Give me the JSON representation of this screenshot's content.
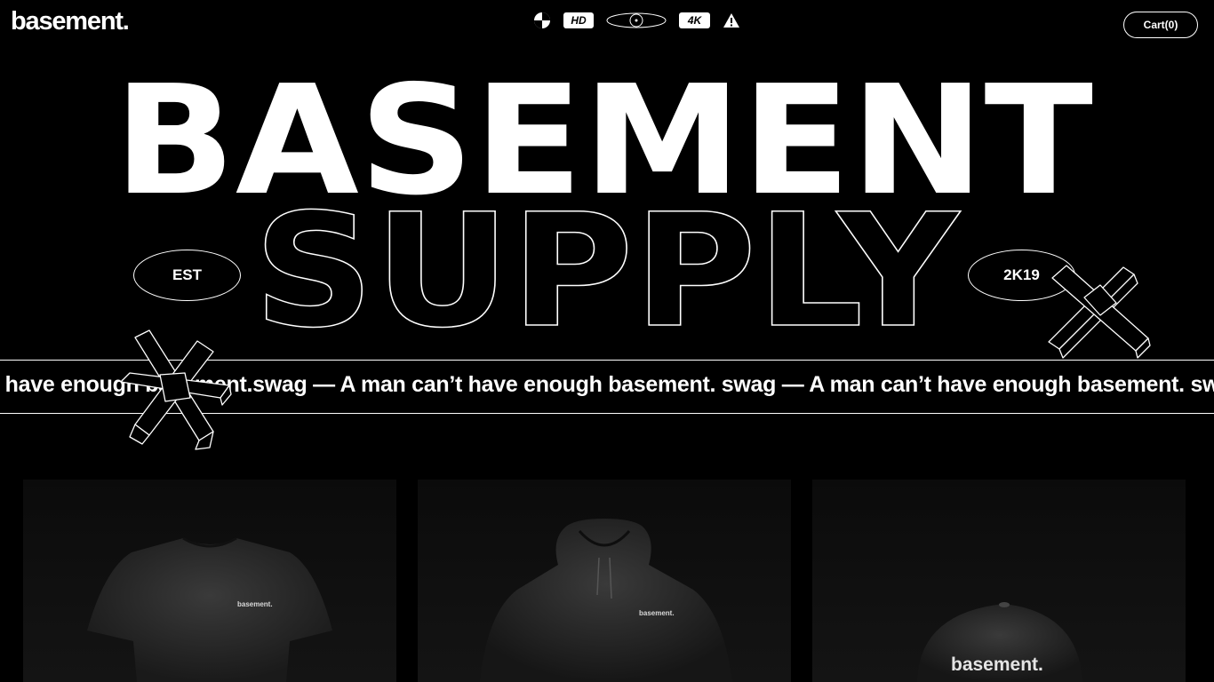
{
  "header": {
    "logo": "basement.",
    "icons": [
      "contrast-icon",
      "hd-badge",
      "eye-icon",
      "4k-badge",
      "warning-icon"
    ],
    "hd_label": "HD",
    "k4_label": "4K",
    "cart_label": "Cart(0)"
  },
  "hero": {
    "line1": "BASEMENT",
    "line2": "SUPPLY",
    "est_label": "EST",
    "year_label": "2K19"
  },
  "marquee": {
    "text": "t have enough basement.swag — A man can’t have enough basement. swag — A man can’t have enough basement. swag"
  },
  "products": [
    {
      "name": "tshirt",
      "logo": "basement."
    },
    {
      "name": "hoodie",
      "logo": "basement."
    },
    {
      "name": "cap",
      "logo": "basement."
    }
  ],
  "colors": {
    "background": "#000000",
    "foreground": "#ffffff"
  }
}
